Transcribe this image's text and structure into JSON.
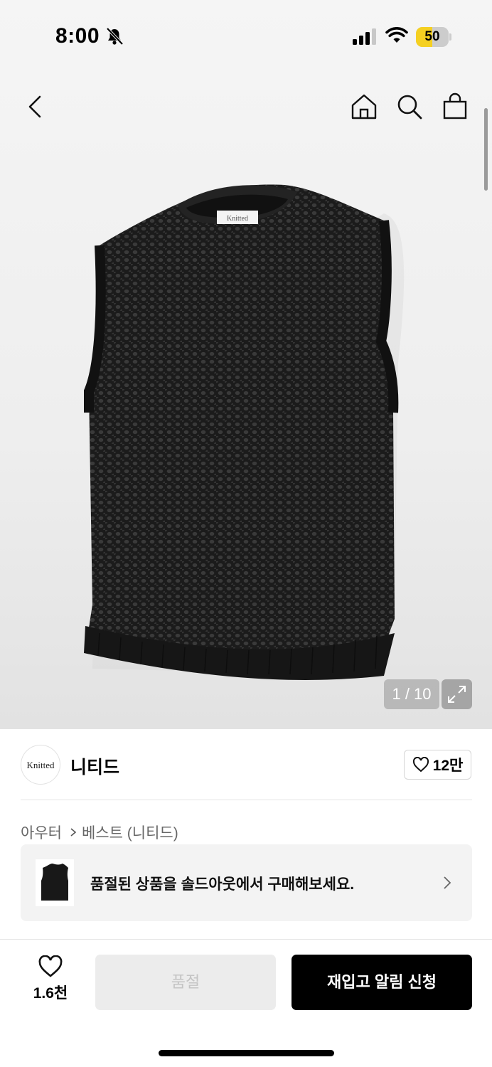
{
  "status_bar": {
    "time": "8:00",
    "battery": "50",
    "battery_level": 0.5,
    "battery_color": "#f5d021",
    "icons": [
      "bell-slash-icon",
      "cellular-signal-icon",
      "wifi-icon",
      "battery-icon"
    ]
  },
  "nav": {
    "icons": [
      "back-arrow-icon",
      "home-icon",
      "search-icon",
      "shopping-bag-icon"
    ]
  },
  "gallery": {
    "label_text": "Knitted",
    "counter": "1 / 10",
    "expand_icon": "expand-icon"
  },
  "brand": {
    "logo_text": "Knitted",
    "name": "니티드",
    "like_count": "12만",
    "like_icon": "heart-outline-icon"
  },
  "breadcrumb": {
    "category": "아우터",
    "subcategory": "베스트 (니티드)"
  },
  "soldout_banner": {
    "text": "품절된 상품을 솔드아웃에서 구매해보세요."
  },
  "bottom_bar": {
    "like_count": "1.6천",
    "soldout_label": "품절",
    "restock_label": "재입고 알림 신청"
  },
  "colors": {
    "primary_button": "#000000",
    "disabled_button": "#ececec",
    "battery_accent": "#f5d021"
  }
}
